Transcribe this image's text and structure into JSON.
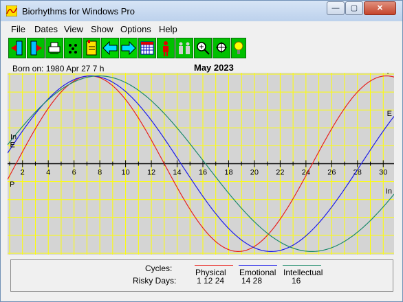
{
  "window": {
    "title": "Biorhythms for Windows Pro",
    "buttons": {
      "minimize": "—",
      "maximize": "▢",
      "close": "✕"
    }
  },
  "menu": [
    "File",
    "Dates",
    "View",
    "Show",
    "Options",
    "Help"
  ],
  "toolbar": [
    {
      "name": "back-date-icon"
    },
    {
      "name": "forward-date-icon"
    },
    {
      "name": "print-icon"
    },
    {
      "name": "dice-icon"
    },
    {
      "name": "calendar-note-icon"
    },
    {
      "name": "arrow-left-icon"
    },
    {
      "name": "arrow-right-icon"
    },
    {
      "name": "grid-calendar-icon"
    },
    {
      "name": "person-icon"
    },
    {
      "name": "couple-icon"
    },
    {
      "name": "zoom-in-icon"
    },
    {
      "name": "zoom-out-icon"
    },
    {
      "name": "lightbulb-icon"
    }
  ],
  "header": {
    "born": "Born on: 1980 Apr 27  7 h",
    "month": "May 2023"
  },
  "chart_data": {
    "type": "line",
    "x_ticks": [
      2,
      4,
      6,
      8,
      10,
      12,
      14,
      16,
      18,
      20,
      22,
      24,
      26,
      28,
      30
    ],
    "xlim": [
      1,
      31
    ],
    "ylim": [
      -1,
      1
    ],
    "grid": true,
    "series": [
      {
        "name": "Physical",
        "period": 23,
        "start_day": 1.5,
        "color": "#e8201c",
        "label": "P"
      },
      {
        "name": "Emotional",
        "period": 28,
        "start_day": 0.3,
        "color": "#1c1ce8",
        "label": "E"
      },
      {
        "name": "Intellectual",
        "period": 33,
        "start_day": -0.3,
        "color": "#1c8a6a",
        "label": "In"
      }
    ],
    "colors": {
      "background": "#d4d4d4",
      "grid": "#ffff00",
      "axis": "#000000"
    }
  },
  "legend": {
    "cycles_label": "Cycles:",
    "risky_label": "Risky Days:",
    "physical": {
      "name": "Physical",
      "risky": "1   12  24",
      "color": "#e8201c"
    },
    "emotional": {
      "name": "Emotional",
      "risky": "14  28",
      "color": "#1c1ce8"
    },
    "intellectual": {
      "name": "Intellectual",
      "risky": "16",
      "color": "#1c8a6a"
    }
  }
}
